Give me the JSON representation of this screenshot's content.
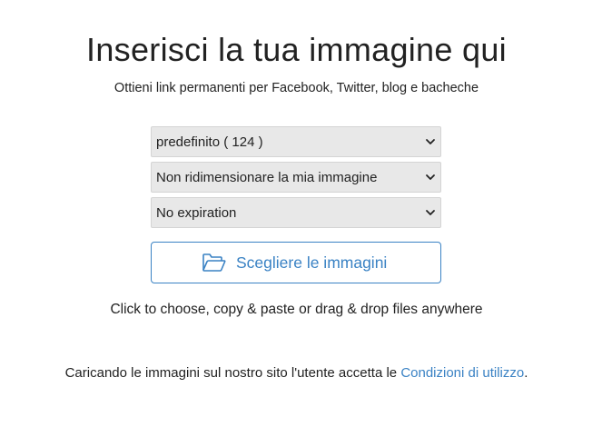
{
  "header": {
    "title": "Inserisci la tua immagine qui",
    "subtitle": "Ottieni link permanenti per Facebook, Twitter, blog e bacheche"
  },
  "options": {
    "album_select": {
      "selected": "predefinito ( 124 )"
    },
    "resize_select": {
      "selected": "Non ridimensionare la mia immagine"
    },
    "expiration_select": {
      "selected": "No expiration"
    }
  },
  "upload": {
    "button_label": "Scegliere le immagini",
    "icon": "folder-open-icon",
    "hint": "Click to choose, copy & paste or drag & drop files anywhere"
  },
  "terms": {
    "prefix": "Caricando le immagini sul nostro sito l'utente accetta le ",
    "link_label": "Condizioni di utilizzo",
    "suffix": "."
  },
  "colors": {
    "accent": "#3a82c4",
    "select_bg": "#e8e8e8",
    "text": "#222222"
  }
}
